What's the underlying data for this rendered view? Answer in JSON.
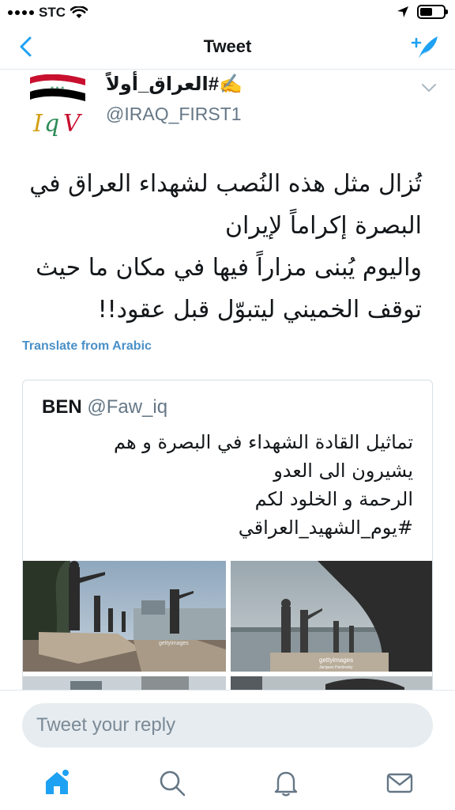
{
  "status_bar": {
    "carrier": "STC",
    "battery_level": 0.55,
    "wifi_icon": "wifi-icon",
    "location_icon": "location-arrow-icon"
  },
  "nav": {
    "title": "Tweet",
    "back_icon": "chevron-left-icon",
    "compose_icon": "compose-tweet-icon"
  },
  "tweet": {
    "display_name": "✍️#العراق_أولاً",
    "handle": "@IRAQ_FIRST1",
    "avatar_logo_text": "IqV",
    "text_lines": [
      "تُزال مثل هذه النُصب لشهداء العراق في",
      "البصرة إكراماً لإيران",
      "واليوم يُبنى مزاراً فيها في مكان ما حيث",
      "توقف الخميني ليتبوّل قبل عقود!!"
    ],
    "translate_label": "Translate from Arabic"
  },
  "quoted_tweet": {
    "display_name": "BEN",
    "handle": "@Faw_iq",
    "text_lines": [
      "تماثيل القادة الشهداء في البصرة و هم",
      "يشيرون الى العدو",
      "الرحمة و الخلود لكم",
      "#يوم_الشهيد_العراقي"
    ],
    "watermark_1": "gettyimages",
    "watermark_2": "gettyimages",
    "watermark_2_credit": "Jacques Pavlovsky"
  },
  "reply": {
    "placeholder": "Tweet your reply"
  },
  "tab_bar": {
    "items": [
      "home-icon",
      "search-icon",
      "notifications-icon",
      "messages-icon"
    ],
    "accent_color": "#1da1f2"
  },
  "colors": {
    "accent": "#1da1f2",
    "secondary_text": "#657786"
  }
}
